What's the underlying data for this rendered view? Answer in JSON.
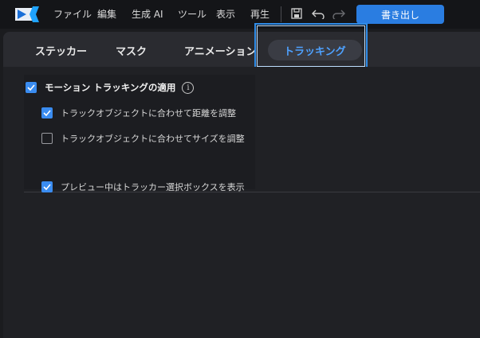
{
  "menu": {
    "items": [
      "ファイル",
      "編集",
      "生成 AI",
      "ツール",
      "表示",
      "再生"
    ],
    "export_label": "書き出し"
  },
  "toolbar_icons": [
    "save-icon",
    "undo-icon",
    "redo-icon"
  ],
  "tabs": [
    {
      "label": "ステッカー",
      "active": false
    },
    {
      "label": "マスク",
      "active": false
    },
    {
      "label": "アニメーション",
      "active": false
    },
    {
      "label": "トラッキング",
      "active": true
    }
  ],
  "options": {
    "main": {
      "label": "モーション トラッキングの適用",
      "checked": true
    },
    "distance": {
      "label": "トラックオブジェクトに合わせて距離を調整",
      "checked": true
    },
    "size": {
      "label": "トラックオブジェクトに合わせてサイズを調整",
      "checked": false
    },
    "preview": {
      "label": "プレビュー中はトラッカー選択ボックスを表示",
      "checked": true
    }
  },
  "colors": {
    "accent": "#2a7de1",
    "checkbox": "#3a8cf0",
    "active_tab_text": "#4ea1ff",
    "focus_outline": "#2f8ce8"
  }
}
